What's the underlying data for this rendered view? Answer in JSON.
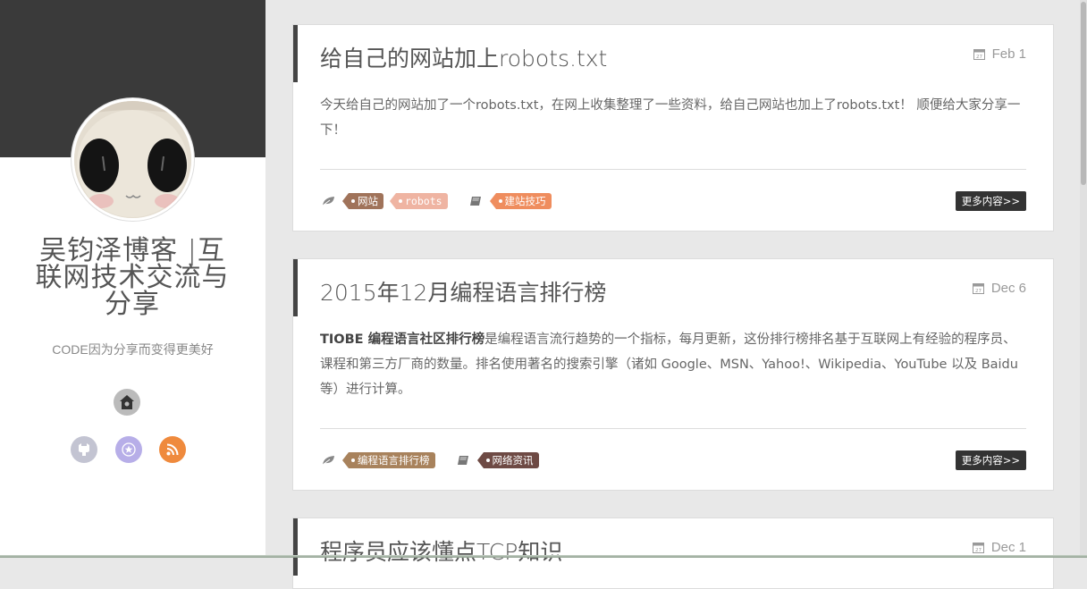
{
  "sidebar": {
    "title": "吴钧泽博客 |互联网技术交流与分享",
    "description": "CODE因为分享而变得更美好",
    "icons": {
      "home": "home-icon",
      "github": "github-icon",
      "star": "star-icon",
      "rss": "rss-icon"
    }
  },
  "posts": [
    {
      "title": "给自己的网站加上robots.txt",
      "date": "Feb 1",
      "excerpt": "今天给自己的网站加了一个robots.txt，在网上收集整理了一些资料，给自己网站也加上了robots.txt！ 顺便给大家分享一下！",
      "tags": [
        {
          "label": "网站",
          "color": "#a0735a"
        },
        {
          "label": "robots",
          "color": "#efb4a2"
        }
      ],
      "categories": [
        {
          "label": "建站技巧",
          "color": "#ef8d5e"
        }
      ],
      "more_label": "更多内容>>"
    },
    {
      "title": "2015年12月编程语言排行榜",
      "date": "Dec 6",
      "excerpt_bold": "TIOBE 编程语言社区排行榜",
      "excerpt": "是编程语言流行趋势的一个指标，每月更新，这份排行榜排名基于互联网上有经验的程序员、 课程和第三方厂商的数量。排名使用著名的搜索引擎（诸如 Google、MSN、Yahoo!、Wikipedia、YouTube 以及 Baidu 等）进行计算。",
      "tags": [
        {
          "label": "编程语言排行榜",
          "color": "#a8825c"
        }
      ],
      "categories": [
        {
          "label": "网络资讯",
          "color": "#6e4a44"
        }
      ],
      "more_label": "更多内容>>"
    },
    {
      "title": "程序员应该懂点TCP知识",
      "date": "Dec 1"
    }
  ],
  "colors": {
    "sidebar_header": "#3a3a3a",
    "accent_bar": "#444444",
    "rss": "#ef8a3d"
  }
}
